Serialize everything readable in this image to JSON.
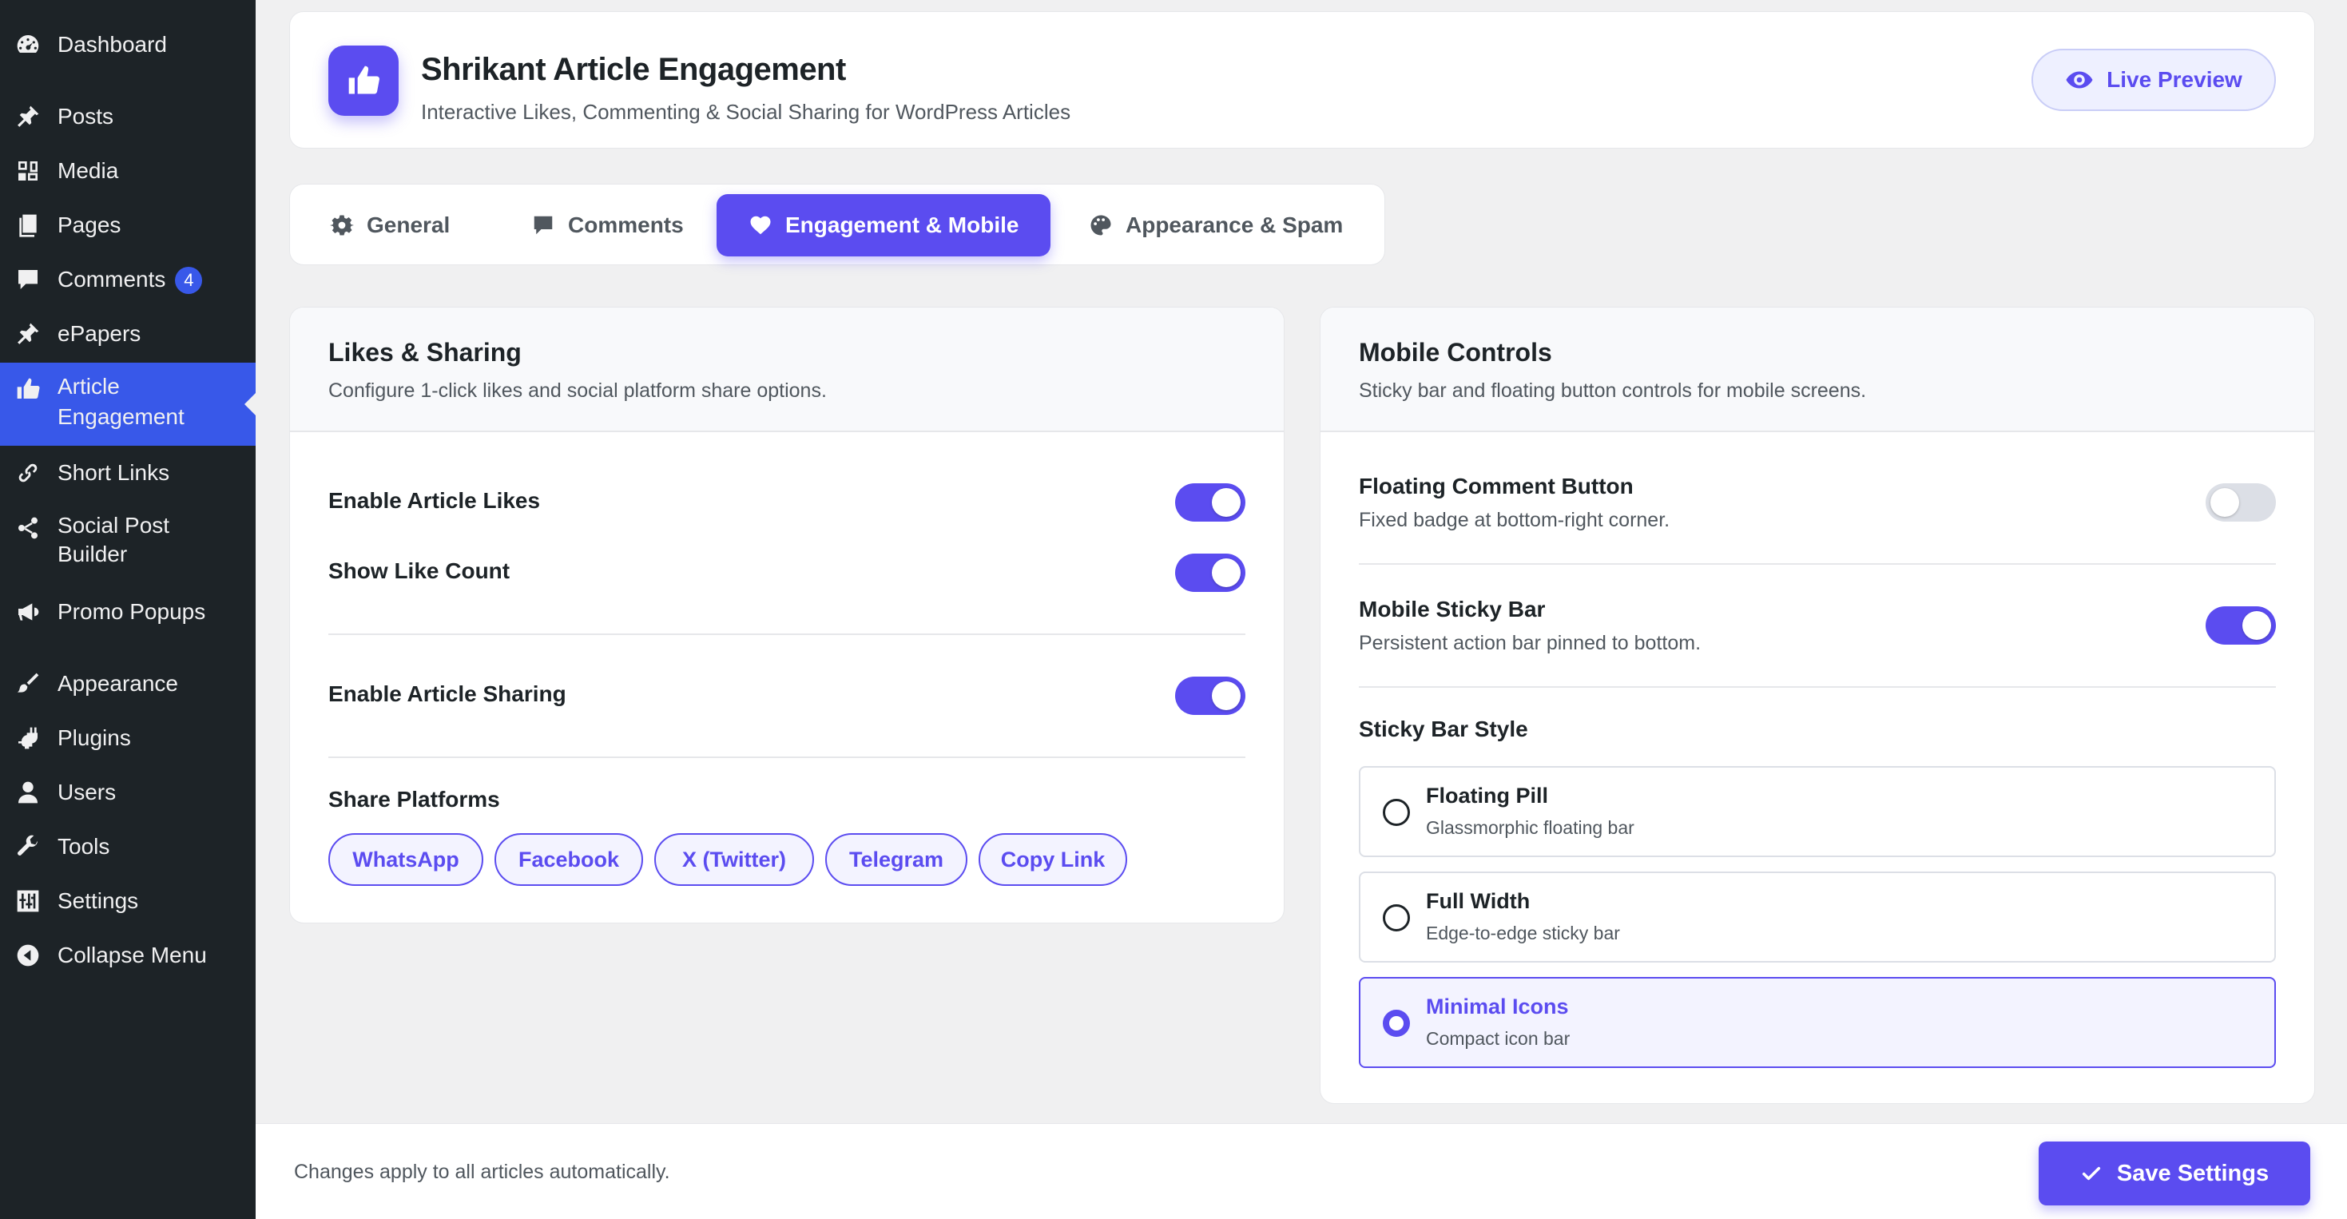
{
  "sidebar": {
    "items": [
      {
        "label": "Dashboard",
        "icon": "dashboard-icon"
      },
      {
        "label": "Posts",
        "icon": "pin-icon"
      },
      {
        "label": "Media",
        "icon": "media-icon"
      },
      {
        "label": "Pages",
        "icon": "pages-icon"
      },
      {
        "label": "Comments",
        "icon": "comment-icon",
        "badge": "4"
      },
      {
        "label": "ePapers",
        "icon": "pin-icon"
      },
      {
        "label": "Article",
        "label2": "Engagement",
        "icon": "thumbs-up-icon",
        "active": true
      },
      {
        "label": "Short Links",
        "icon": "link-icon"
      },
      {
        "label": "Social Post",
        "label2": "Builder",
        "icon": "share-icon"
      },
      {
        "label": "Promo Popups",
        "icon": "megaphone-icon"
      },
      {
        "label": "Appearance",
        "icon": "brush-icon"
      },
      {
        "label": "Plugins",
        "icon": "plug-icon"
      },
      {
        "label": "Users",
        "icon": "user-icon"
      },
      {
        "label": "Tools",
        "icon": "wrench-icon"
      },
      {
        "label": "Settings",
        "icon": "sliders-icon"
      },
      {
        "label": "Collapse Menu",
        "icon": "collapse-icon"
      }
    ]
  },
  "header": {
    "title": "Shrikant Article Engagement",
    "subtitle": "Interactive Likes, Commenting & Social Sharing for WordPress Articles",
    "live_preview": "Live Preview"
  },
  "tabs": [
    {
      "label": "General",
      "icon": "gear-icon"
    },
    {
      "label": "Comments",
      "icon": "comment-icon"
    },
    {
      "label": "Engagement & Mobile",
      "icon": "heart-icon",
      "active": true
    },
    {
      "label": "Appearance & Spam",
      "icon": "palette-icon"
    }
  ],
  "likes": {
    "title": "Likes & Sharing",
    "subtitle": "Configure 1-click likes and social platform share options.",
    "enable_likes": {
      "label": "Enable Article Likes",
      "on": true
    },
    "show_count": {
      "label": "Show Like Count",
      "on": true
    },
    "enable_sharing": {
      "label": "Enable Article Sharing",
      "on": true
    },
    "platforms_label": "Share Platforms",
    "platforms": [
      "WhatsApp",
      "Facebook",
      "X (Twitter)",
      "Telegram",
      "Copy Link"
    ]
  },
  "mobile": {
    "title": "Mobile Controls",
    "subtitle": "Sticky bar and floating button controls for mobile screens.",
    "floating_button": {
      "label": "Floating Comment Button",
      "desc": "Fixed badge at bottom-right corner.",
      "on": false
    },
    "sticky_bar": {
      "label": "Mobile Sticky Bar",
      "desc": "Persistent action bar pinned to bottom.",
      "on": true
    },
    "style_label": "Sticky Bar Style",
    "styles": [
      {
        "title": "Floating Pill",
        "desc": "Glassmorphic floating bar",
        "selected": false
      },
      {
        "title": "Full Width",
        "desc": "Edge-to-edge sticky bar",
        "selected": false
      },
      {
        "title": "Minimal Icons",
        "desc": "Compact icon bar",
        "selected": true
      }
    ]
  },
  "footer": {
    "note": "Changes apply to all articles automatically.",
    "save_label": "Save Settings"
  },
  "colors": {
    "accent": "#5b4cf0",
    "sidebar_bg": "#1d2327",
    "sidebar_active": "#3858e9",
    "page_bg": "#f0f0f1"
  }
}
